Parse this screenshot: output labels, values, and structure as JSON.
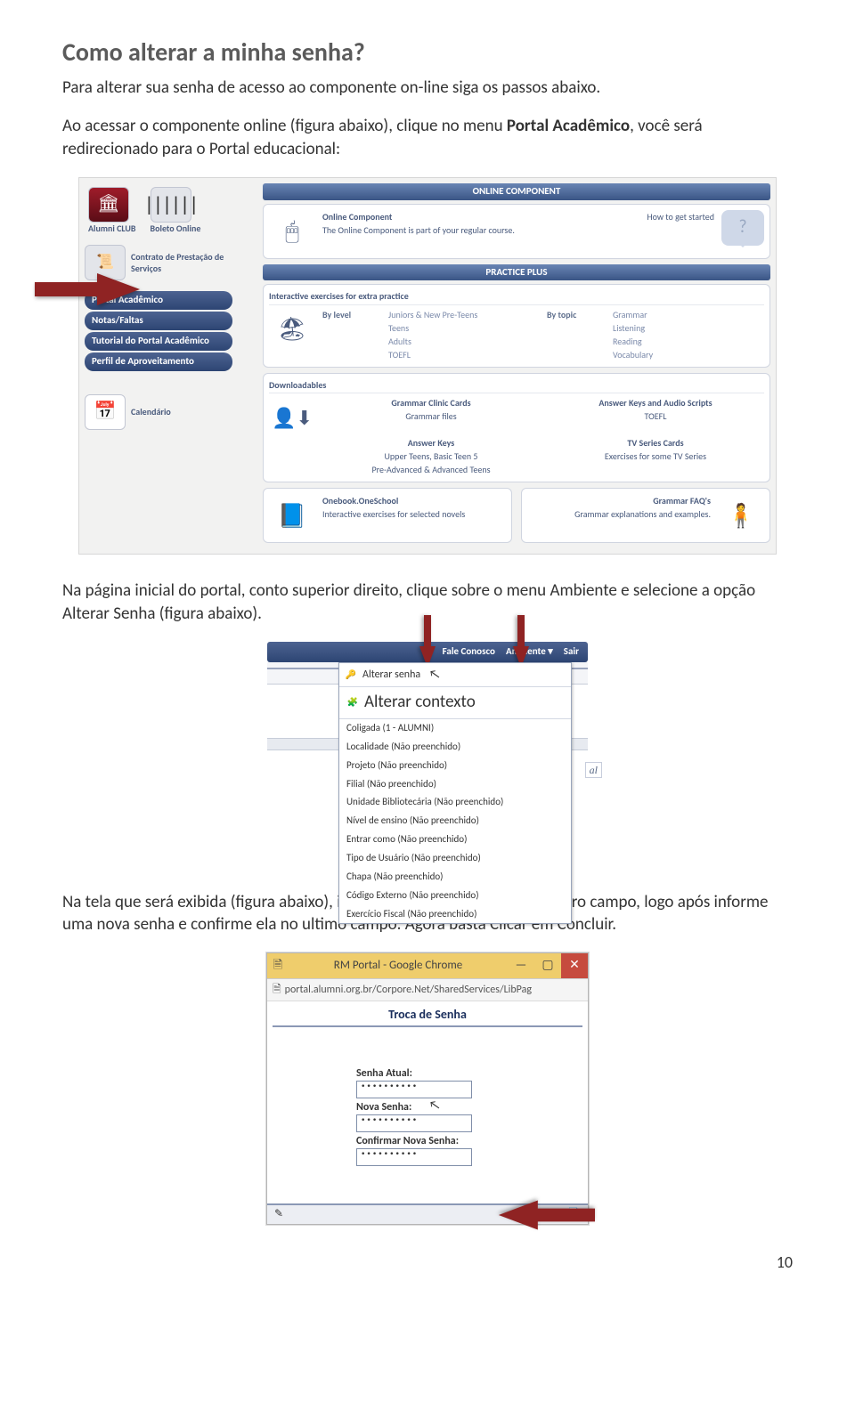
{
  "page": {
    "title": "Como alterar a minha senha?",
    "intro": "Para alterar sua senha de acesso ao componente on-line siga os passos abaixo.",
    "para2_a": "Ao acessar o componente online (figura abaixo), clique no menu ",
    "para2_b": "Portal Acadêmico",
    "para2_c": ", você será redirecionado para o Portal educacional:",
    "para3": "Na página inicial do portal, conto superior direito, clique sobre o menu Ambiente e selecione a opção Alterar Senha (figura abaixo).",
    "para4": "Na tela que será exibida (figura abaixo), informe sua senha atual no primeiro campo, logo após informe uma nova senha e confirme ela no ultimo campo. Agora basta Clicar em Concluir.",
    "pageno": "10"
  },
  "fig1": {
    "left_top": [
      {
        "label": "Alumni CLUB"
      },
      {
        "label": "Boleto Online"
      }
    ],
    "contrato": "Contrato de Prestação de Serviços",
    "sidebtns": [
      "Portal Acadêmico",
      "Notas/Faltas",
      "Tutorial do Portal Acadêmico",
      "Perfil de Aproveitamento"
    ],
    "calendar": "Calendário",
    "banner_oc": "ONLINE COMPONENT",
    "oc_title": "Online Component",
    "oc_sub": "The Online Component is part of your regular course.",
    "how_to": "How to get started",
    "banner_pp": "PRACTICE PLUS",
    "pp_head": "Interactive exercises for extra practice",
    "bylevel_label": "By level",
    "bylevel_items": [
      "Juniors & New Pre-Teens",
      "Teens",
      "Adults",
      "TOEFL"
    ],
    "bytopic_label": "By topic",
    "bytopic_items": [
      "Grammar",
      "Listening",
      "Reading",
      "Vocabulary"
    ],
    "down_head": "Downloadables",
    "down_left": [
      "Grammar Clinic Cards",
      "Grammar files",
      "",
      "Answer Keys",
      "Upper Teens, Basic Teen 5",
      "Pre-Advanced & Advanced Teens"
    ],
    "down_right": [
      "Answer Keys and Audio Scripts",
      "TOEFL",
      "",
      "TV Series Cards",
      "Exercises for some TV Series"
    ],
    "bot_left_t": "Onebook.OneSchool",
    "bot_left_s": "Interactive exercises for selected novels",
    "bot_right_t": "Grammar FAQ's",
    "bot_right_s": "Grammar explanations and examples."
  },
  "fig2": {
    "top": [
      "Fale Conosco",
      "Ambiente ▾",
      "Sair"
    ],
    "alterar_senha": "Alterar senha",
    "alterar_contexto": "Alterar contexto",
    "items": [
      "Coligada (1 - ALUMNI)",
      "Localidade (Não preenchido)",
      "Projeto (Não preenchido)",
      "Filial (Não preenchido)",
      "Unidade Bibliotecária (Não preenchido)",
      "Nível de ensino (Não preenchido)",
      "Entrar como (Não preenchido)",
      "Tipo de Usuário (Não preenchido)",
      "Chapa (Não preenchido)",
      "Código Externo (Não preenchido)",
      "Exercício Fiscal (Não preenchido)"
    ],
    "side_label": "al"
  },
  "fig3": {
    "window_title": "RM Portal - Google Chrome",
    "url": "portal.alumni.org.br/Corpore.Net/SharedServices/LibPag",
    "heading": "Troca de Senha",
    "f1": "Senha Atual:",
    "f2": "Nova Senha:",
    "f3": "Confirmar Nova Senha:",
    "dots": "••••••••••"
  }
}
